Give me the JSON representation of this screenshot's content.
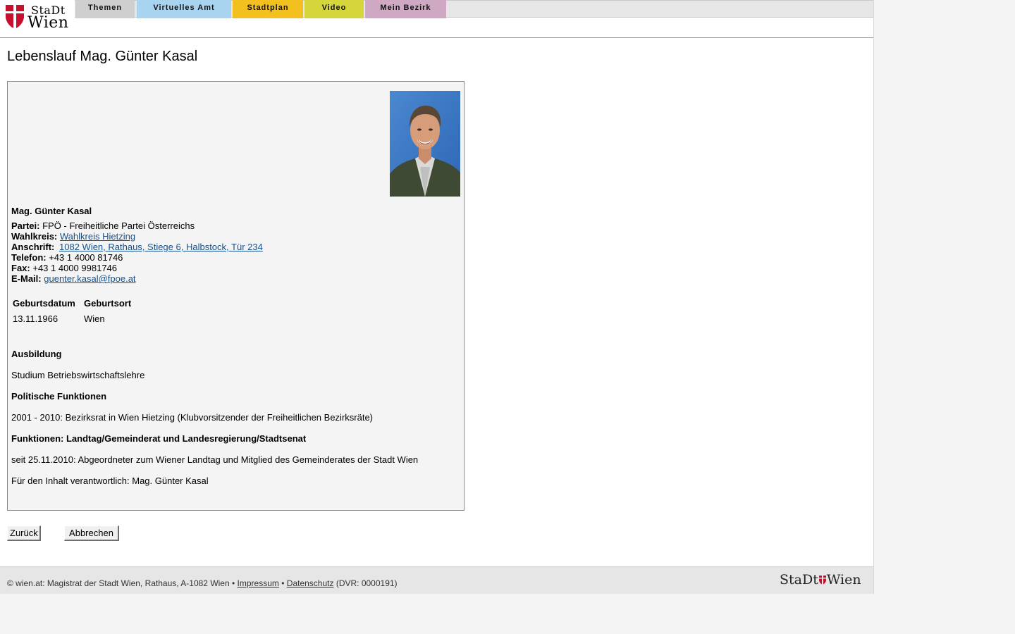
{
  "logo": {
    "stadt": "StaDt",
    "wien": "Wien",
    "brand_red": "#c8102e"
  },
  "nav": {
    "tabs": [
      {
        "label": "Themen",
        "color": "#cfcfcf"
      },
      {
        "label": "Virtuelles Amt",
        "color": "#a9d4ef"
      },
      {
        "label": "Stadtplan",
        "color": "#f3c11f"
      },
      {
        "label": "Video",
        "color": "#d4d63b"
      },
      {
        "label": "Mein Bezirk",
        "color": "#cfa9c3"
      }
    ]
  },
  "page": {
    "title": "Lebenslauf Mag. Günter Kasal"
  },
  "profile": {
    "name": "Mag. Günter Kasal",
    "partei_label": "Partei:",
    "partei_value": "FPÖ - Freiheitliche Partei Österreichs",
    "wahlkreis_label": "Wahlkreis:",
    "wahlkreis_value": "Wahlkreis Hietzing",
    "anschrift_label": "Anschrift:",
    "anschrift_value": "1082 Wien, Rathaus, Stiege 6, Halbstock, Tür 234",
    "telefon_label": "Telefon:",
    "telefon_value": "+43 1 4000 81746",
    "fax_label": "Fax:",
    "fax_value": "+43 1 4000 9981746",
    "email_label": "E-Mail:",
    "email_value": "guenter.kasal@fpoe.at"
  },
  "birth_table": {
    "headers": [
      "Geburtsdatum",
      "Geburtsort"
    ],
    "row": [
      "13.11.1966",
      "Wien"
    ]
  },
  "sections": {
    "ausbildung_heading": "Ausbildung",
    "ausbildung_text": "Studium Betriebswirtschaftslehre",
    "politisch_heading": "Politische Funktionen",
    "politisch_text": "2001 - 2010: Bezirksrat in Wien Hietzing (Klubvorsitzender der Freiheitlichen Bezirksräte)",
    "funktionen_heading": "Funktionen: Landtag/Gemeinderat und Landesregierung/Stadtsenat",
    "funktionen_text": "seit 25.11.2010: Abgeordneter zum Wiener Landtag und Mitglied des Gemeinderates der Stadt Wien",
    "verantwortlich": "Für den Inhalt verantwortlich: Mag. Günter Kasal"
  },
  "buttons": {
    "back": "Zurück",
    "cancel": "Abbrechen"
  },
  "footer": {
    "text_before": "© wien.at: Magistrat der Stadt Wien, Rathaus, A-1082 Wien •",
    "impressum": "Impressum",
    "separator": "•",
    "datenschutz": "Datenschutz",
    "dvr": "(DVR: 0000191)",
    "logo_stadt": "StaDt",
    "logo_wien": "Wien"
  }
}
